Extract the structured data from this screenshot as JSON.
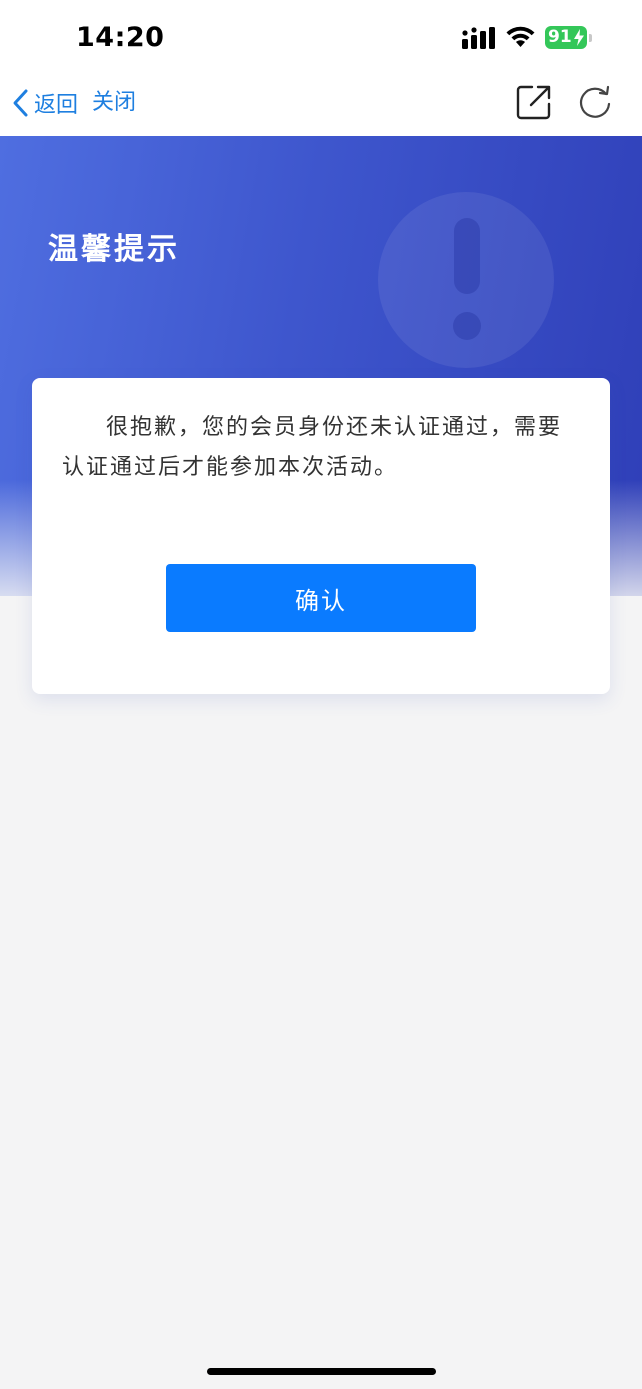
{
  "status_bar": {
    "time": "14:20",
    "battery_level": "91",
    "battery_color": "#34c759"
  },
  "nav": {
    "back_label": "返回",
    "close_label": "关闭",
    "link_color": "#1e7fe0",
    "icons": [
      "chevron-left-icon",
      "share-icon",
      "refresh-icon"
    ]
  },
  "banner": {
    "title": "温馨提示",
    "background_color": "#3e56cd",
    "decoration_icon": "exclamation-circle-icon"
  },
  "dialog": {
    "message": "很抱歉，您的会员身份还未认证通过，需要认证通过后才能参加本次活动。",
    "confirm_label": "确认",
    "button_color": "#0a7bff"
  }
}
